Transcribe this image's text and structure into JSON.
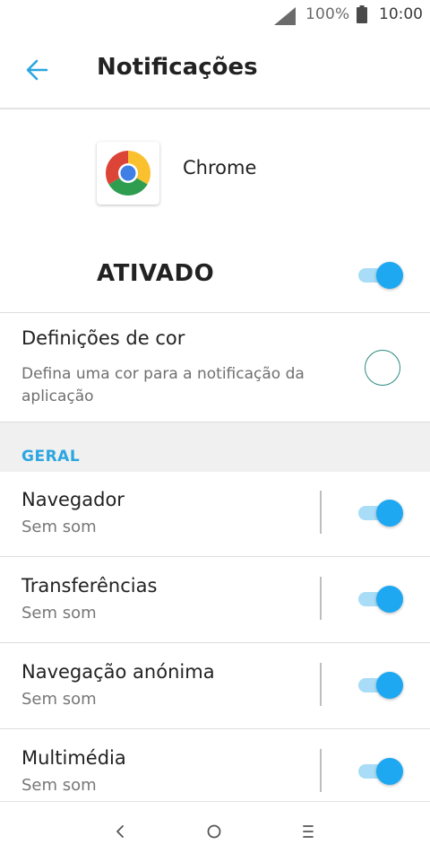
{
  "status_bar": {
    "battery_percent": "100%",
    "time": "10:00",
    "icons": [
      "signal-icon",
      "battery-icon"
    ]
  },
  "toolbar": {
    "title": "Notificações",
    "back_icon": "arrow-back-icon",
    "accent_color": "#2aa6e0"
  },
  "app": {
    "name": "Chrome",
    "icon": "chrome-logo-icon"
  },
  "master_toggle": {
    "label": "ATIVADO",
    "on": true
  },
  "color_setting": {
    "title": "Definições de cor",
    "description": "Defina uma cor para a notificação da aplicação"
  },
  "section": {
    "label": "GERAL"
  },
  "channels": [
    {
      "title": "Navegador",
      "subtitle": "Sem som",
      "on": true
    },
    {
      "title": "Transferências",
      "subtitle": "Sem som",
      "on": true
    },
    {
      "title": "Navegação anónima",
      "subtitle": "Sem som",
      "on": true
    },
    {
      "title": "Multimédia",
      "subtitle": "Sem som",
      "on": true
    }
  ],
  "nav_bar": {
    "icons": [
      "nav-back-icon",
      "nav-home-icon",
      "nav-menu-icon"
    ]
  },
  "colors": {
    "toggle_thumb": "#1ea8f2",
    "toggle_track": "#a8dcf7"
  }
}
